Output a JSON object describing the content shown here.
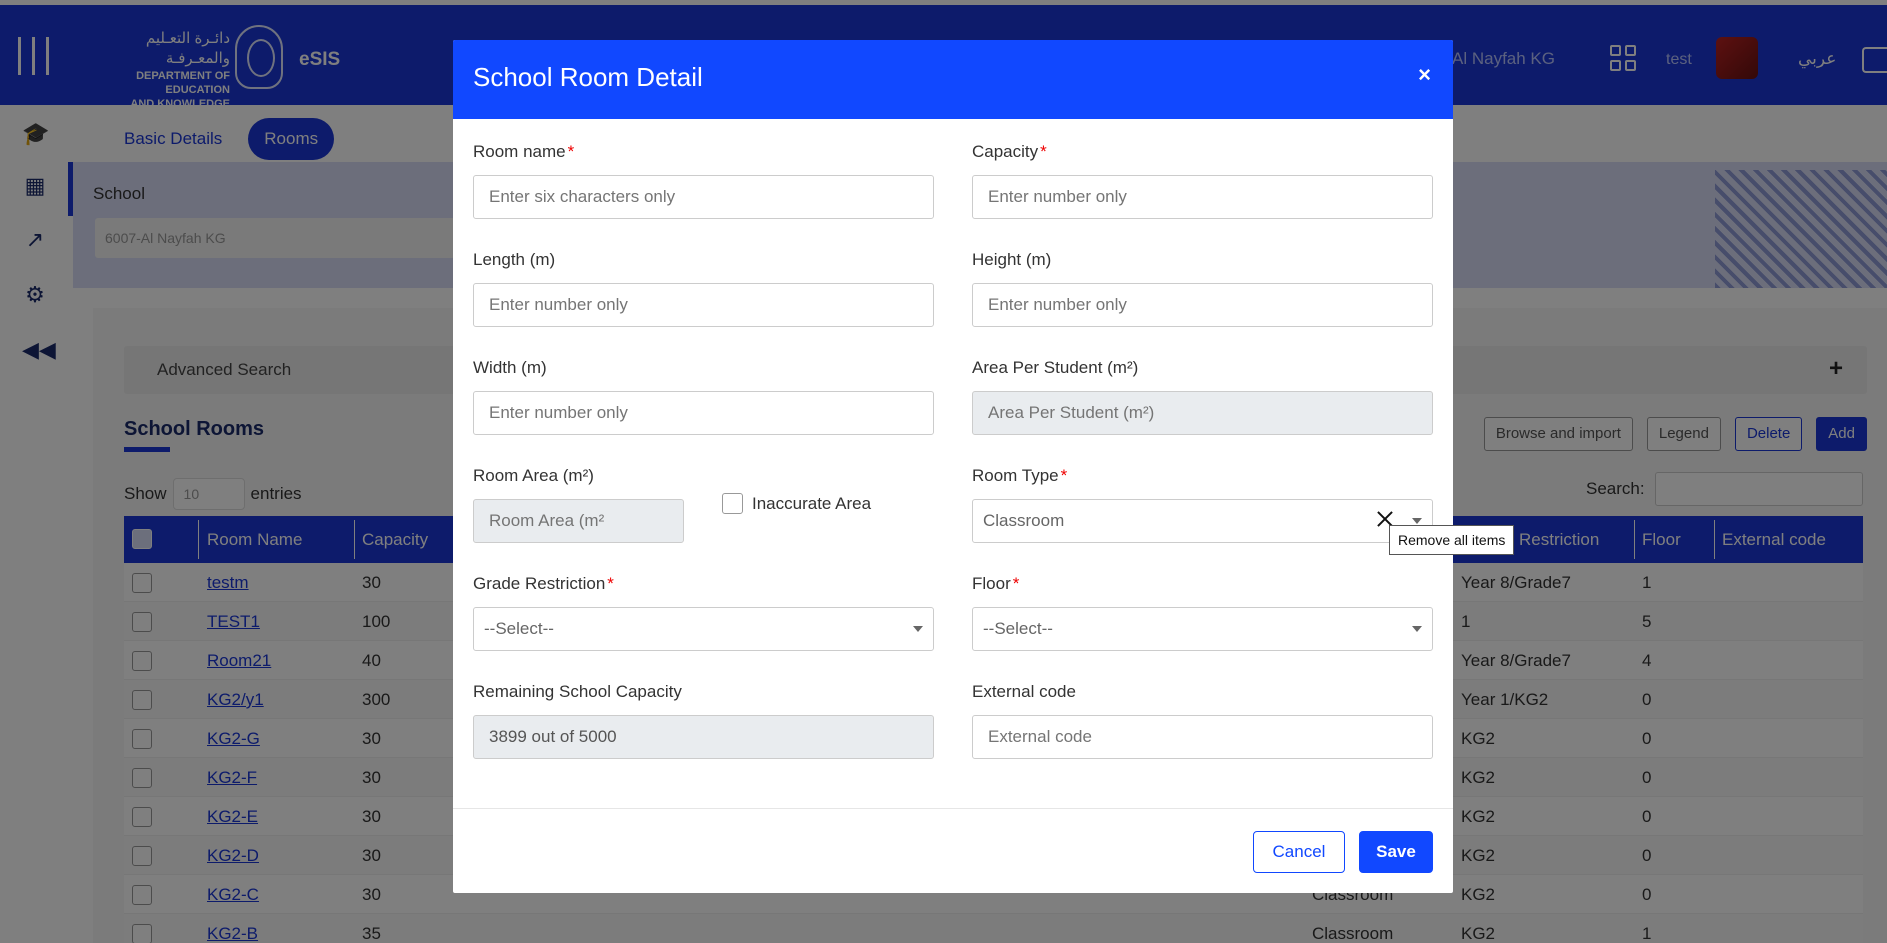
{
  "header": {
    "logo_arabic": "دائـرة التعـليم والمعـرفـة",
    "logo_line1": "DEPARTMENT OF EDUCATION",
    "logo_line2": "AND KNOWLEDGE",
    "app_name": "eSIS",
    "school_name": "Al Nayfah KG",
    "user_name": "test",
    "language_toggle": "عربي"
  },
  "sidebar": {
    "icons": [
      "graduation-cap-icon",
      "building-icon",
      "chart-icon",
      "gear-icon",
      "rewind-icon"
    ]
  },
  "tabs": [
    {
      "label": "Basic Details"
    },
    {
      "label": "Rooms"
    }
  ],
  "school_selector": {
    "label": "School",
    "value": "6007-Al Nayfah KG"
  },
  "advanced_search": {
    "label": "Advanced Search",
    "toggle": "+"
  },
  "rooms_section": {
    "title": "School Rooms",
    "show_label": "Show",
    "entries_value": "10",
    "entries_label": "entries",
    "search_label": "Search:",
    "buttons": [
      "Browse and import",
      "Legend",
      "Delete",
      "Add"
    ],
    "columns": [
      "Room Name",
      "Capacity",
      "Restriction",
      "Floor",
      "External code"
    ],
    "rows": [
      {
        "name": "testm",
        "capacity": "30",
        "type": "",
        "restriction": "Year 8/Grade7",
        "floor": "1"
      },
      {
        "name": "TEST1",
        "capacity": "100",
        "type": "",
        "restriction": "1",
        "floor": "5"
      },
      {
        "name": "Room21",
        "capacity": "40",
        "type": "",
        "restriction": "Year 8/Grade7",
        "floor": "4"
      },
      {
        "name": "KG2/y1",
        "capacity": "300",
        "type": "",
        "restriction": "Year 1/KG2",
        "floor": "0"
      },
      {
        "name": "KG2-G",
        "capacity": "30",
        "type": "",
        "restriction": "KG2",
        "floor": "0"
      },
      {
        "name": "KG2-F",
        "capacity": "30",
        "type": "",
        "restriction": "KG2",
        "floor": "0"
      },
      {
        "name": "KG2-E",
        "capacity": "30",
        "type": "",
        "restriction": "KG2",
        "floor": "0"
      },
      {
        "name": "KG2-D",
        "capacity": "30",
        "type": "",
        "restriction": "KG2",
        "floor": "0"
      },
      {
        "name": "KG2-C",
        "capacity": "30",
        "type": "Classroom",
        "restriction": "KG2",
        "floor": "0"
      },
      {
        "name": "KG2-B",
        "capacity": "35",
        "type": "Classroom",
        "restriction": "KG2",
        "floor": "1"
      }
    ]
  },
  "modal": {
    "title": "School Room Detail",
    "close": "×",
    "fields": {
      "room_name": {
        "label": "Room name",
        "placeholder": "Enter six characters only"
      },
      "capacity": {
        "label": "Capacity",
        "placeholder": "Enter number only"
      },
      "length": {
        "label": "Length (m)",
        "placeholder": "Enter number only"
      },
      "height": {
        "label": "Height (m)",
        "placeholder": "Enter number only"
      },
      "width": {
        "label": "Width (m)",
        "placeholder": "Enter number only"
      },
      "area_per_student": {
        "label": "Area Per Student (m²)",
        "placeholder": "Area Per Student (m²)"
      },
      "room_area": {
        "label": "Room Area (m²)",
        "placeholder": "Room Area (m²"
      },
      "inaccurate_area": {
        "label": "Inaccurate Area"
      },
      "room_type": {
        "label": "Room Type",
        "value": "Classroom"
      },
      "grade_restriction": {
        "label": "Grade Restriction",
        "value": "--Select--"
      },
      "floor": {
        "label": "Floor",
        "value": "--Select--"
      },
      "remaining_capacity": {
        "label": "Remaining School Capacity",
        "value": "3899 out of 5000"
      },
      "external_code": {
        "label": "External code",
        "placeholder": "External code"
      }
    },
    "required_mark": "*",
    "tooltip": "Remove all items",
    "cancel_label": "Cancel",
    "save_label": "Save"
  },
  "colors": {
    "primary": "#1148ff",
    "topbar": "#1a36d6",
    "required": "#e00000"
  }
}
